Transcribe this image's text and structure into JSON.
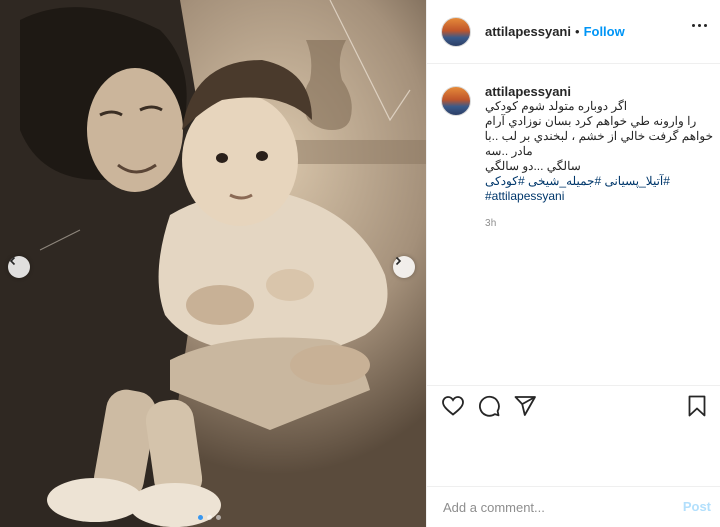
{
  "post": {
    "username": "attilapessyani",
    "separator": "•",
    "follow_label": "Follow",
    "caption_lines": [
      "اگر دوباره متولد شوم کودکي",
      "را وارونه طي خواهم کرد بسان نوزادي آرام",
      "خواهم گرفت خالي از خشم ، لبخندي بر لب ..با",
      "مادر ..سه",
      "سالگي ...دو سالگي"
    ],
    "hashtags_line1": "#آتیلا_پسیانی #جمیله_شیخی #کودکی",
    "hashtags_line2": "#attilapessyani",
    "time": "3h"
  },
  "comment": {
    "placeholder": "Add a comment...",
    "post_label": "Post"
  },
  "carousel": {
    "slide_count": 3,
    "active_index": 0
  },
  "icons": {
    "like": "heart-icon",
    "comment": "comment-bubble-icon",
    "share": "paper-plane-icon",
    "save": "bookmark-icon",
    "prev": "chevron-left-icon",
    "next": "chevron-right-icon",
    "more": "more-dots-icon"
  },
  "colors": {
    "accent": "#0095f6",
    "hashtag": "#00376b",
    "muted": "#8e8e8e",
    "post_disabled": "#b2dffc"
  }
}
